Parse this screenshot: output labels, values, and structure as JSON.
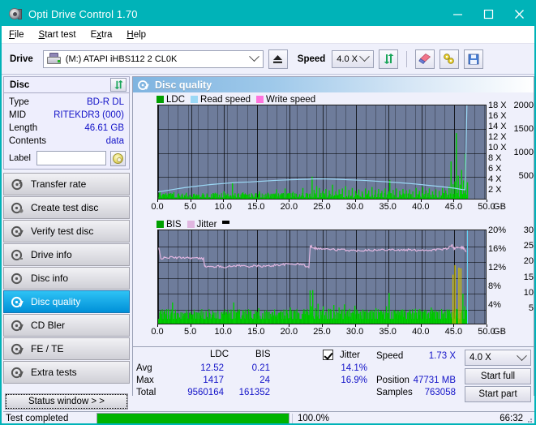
{
  "window": {
    "title": "Opti Drive Control 1.70",
    "icon": "disc-icon",
    "minimize": "minimize-icon",
    "maximize": "maximize-icon",
    "close": "close-icon",
    "titlebar_color": "#00b3b8"
  },
  "menu": [
    {
      "label": "File",
      "accel": "F"
    },
    {
      "label": "Start test",
      "accel": "S"
    },
    {
      "label": "Extra",
      "accel": "x"
    },
    {
      "label": "Help",
      "accel": "H"
    }
  ],
  "toolbar": {
    "drive_label": "Drive",
    "drive_value": "(M:)  ATAPI iHBS112  2 CL0K",
    "eject_icon": "eject-icon",
    "speed_label": "Speed",
    "speed_value": "4.0 X",
    "refresh_icon": "refresh-icon",
    "eraser_icon": "eraser-icon",
    "tools_icon": "tools-icon",
    "save_icon": "save-icon"
  },
  "disc_panel": {
    "header": "Disc",
    "refresh_icon": "refresh-icon",
    "rows": [
      {
        "key": "Type",
        "value": "BD-R DL"
      },
      {
        "key": "MID",
        "value": "RITEKDR3 (000)"
      },
      {
        "key": "Length",
        "value": "46.61 GB"
      },
      {
        "key": "Contents",
        "value": "data"
      }
    ],
    "label_key": "Label",
    "label_value": "",
    "label_placeholder": "",
    "cd_icon": "cd-icon"
  },
  "nav": {
    "items": [
      {
        "label": "Transfer rate",
        "icon": "disc-transfer-icon",
        "selected": false
      },
      {
        "label": "Create test disc",
        "icon": "disc-create-icon",
        "selected": false
      },
      {
        "label": "Verify test disc",
        "icon": "disc-verify-icon",
        "selected": false
      },
      {
        "label": "Drive info",
        "icon": "drive-info-icon",
        "selected": false
      },
      {
        "label": "Disc info",
        "icon": "disc-info-icon",
        "selected": false
      },
      {
        "label": "Disc quality",
        "icon": "disc-quality-icon",
        "selected": true
      },
      {
        "label": "CD Bler",
        "icon": "cd-bler-icon",
        "selected": false
      },
      {
        "label": "FE / TE",
        "icon": "fe-te-icon",
        "selected": false
      },
      {
        "label": "Extra tests",
        "icon": "extra-tests-icon",
        "selected": false
      }
    ],
    "status_window": "Status window > >"
  },
  "content": {
    "header": "Disc quality",
    "header_icon": "disc-quality-icon"
  },
  "stats": {
    "col_ldc": "LDC",
    "col_bis": "BIS",
    "row_avg": "Avg",
    "row_max": "Max",
    "row_total": "Total",
    "ldc_avg": "12.52",
    "ldc_max": "1417",
    "ldc_total": "9560164",
    "bis_avg": "0.21",
    "bis_max": "24",
    "bis_total": "161352",
    "jitter_label": "Jitter",
    "jitter_checked": true,
    "jitter_avg": "14.1%",
    "jitter_max": "16.9%",
    "speed_label": "Speed",
    "speed_value": "1.73 X",
    "position_label": "Position",
    "position_value": "47731 MB",
    "samples_label": "Samples",
    "samples_value": "763058",
    "speed_select": "4.0 X",
    "start_full": "Start full",
    "start_part": "Start part"
  },
  "statusbar": {
    "text": "Test completed",
    "percent": "100.0%",
    "progress": 100,
    "elapsed": "66:32",
    "progress_color": "#00b300"
  },
  "chart_data": [
    {
      "id": "ldc-chart",
      "type": "line",
      "title": "",
      "xlabel": "GB",
      "ylabel": "",
      "xlim": [
        0,
        50
      ],
      "ylim": [
        0,
        2000
      ],
      "y2lim": [
        0,
        18
      ],
      "xticks": [
        "0.0",
        "5.0",
        "10.0",
        "15.0",
        "20.0",
        "25.0",
        "30.0",
        "35.0",
        "40.0",
        "45.0",
        "50.0"
      ],
      "xtick_values": [
        0,
        5,
        10,
        15,
        20,
        25,
        30,
        35,
        40,
        45,
        50
      ],
      "x_unit": "GB",
      "yticks": [
        "500",
        "1000",
        "1500",
        "2000"
      ],
      "ytick_values": [
        500,
        1000,
        1500,
        2000
      ],
      "y2ticks": [
        "2 X",
        "4 X",
        "6 X",
        "8 X",
        "10 X",
        "12 X",
        "14 X",
        "16 X",
        "18 X"
      ],
      "y2tick_values": [
        2,
        4,
        6,
        8,
        10,
        12,
        14,
        16,
        18
      ],
      "grid": true,
      "legend_position": "top-left",
      "legend": [
        {
          "name": "LDC",
          "color": "#00b400"
        },
        {
          "name": "Read speed",
          "color": "#9bd8f5"
        },
        {
          "name": "Write speed",
          "color": "#ff74de"
        }
      ],
      "series": [
        {
          "name": "Read speed",
          "color": "#9bd8f5",
          "axis": "right",
          "x": [
            0.0,
            1.0,
            2.5,
            4.0,
            6.0,
            8.0,
            10.0,
            12.0,
            14.0,
            16.0,
            18.0,
            20.0,
            21.5,
            23.0,
            23.3,
            24.0,
            25.5,
            27.0,
            29.0,
            31.0,
            33.0,
            35.0,
            37.0,
            39.0,
            41.0,
            43.0,
            45.0,
            46.2,
            46.6,
            46.7,
            46.8,
            46.9
          ],
          "values": [
            1.6,
            1.8,
            2.1,
            2.4,
            2.7,
            3.0,
            3.2,
            3.4,
            3.5,
            3.65,
            3.8,
            3.9,
            3.95,
            4.0,
            4.05,
            4.08,
            4.05,
            4.0,
            3.9,
            3.8,
            3.65,
            3.5,
            3.3,
            3.1,
            2.85,
            2.6,
            2.3,
            2.05,
            2.0,
            5.0,
            12.0,
            18.0
          ]
        },
        {
          "name": "LDC",
          "color": "#00b400",
          "axis": "left",
          "note": "dense green spike histogram, baseline ~60, typical spikes 100-350, large spikes near 44-47 GB up to 1417",
          "baseline": 60,
          "spike_x": [
            0.2,
            0.6,
            1.1,
            1.7,
            2.3,
            2.9,
            3.5,
            4.2,
            4.8,
            5.4,
            6.1,
            6.7,
            7.3,
            8.0,
            8.6,
            9.2,
            9.9,
            10.5,
            11.2,
            11.6,
            12.1,
            12.8,
            13.4,
            14.1,
            14.7,
            15.3,
            16.0,
            16.6,
            17.3,
            17.9,
            18.5,
            19.2,
            19.8,
            20.4,
            20.9,
            21.4,
            21.9,
            22.4,
            22.9,
            23.3,
            23.6,
            24.0,
            24.4,
            24.9,
            25.4,
            25.9,
            26.4,
            26.9,
            27.4,
            27.9,
            28.4,
            28.9,
            29.4,
            29.9,
            30.4,
            30.9,
            31.4,
            31.9,
            32.4,
            32.9,
            33.4,
            33.9,
            34.4,
            34.9,
            35.1,
            35.6,
            36.1,
            36.6,
            37.1,
            37.6,
            38.1,
            38.6,
            39.1,
            39.6,
            40.1,
            40.6,
            41.1,
            41.6,
            42.1,
            42.6,
            43.1,
            43.6,
            44.1,
            44.4,
            44.7,
            45.0,
            45.2,
            45.5,
            45.8,
            46.0,
            46.3,
            46.6,
            46.9
          ],
          "spike_values": [
            190,
            120,
            150,
            110,
            170,
            130,
            120,
            160,
            110,
            140,
            120,
            150,
            110,
            130,
            160,
            120,
            190,
            140,
            380,
            150,
            130,
            170,
            120,
            150,
            130,
            190,
            120,
            160,
            140,
            230,
            130,
            250,
            150,
            180,
            140,
            130,
            260,
            150,
            130,
            500,
            220,
            300,
            260,
            200,
            240,
            210,
            330,
            190,
            230,
            250,
            300,
            220,
            260,
            200,
            230,
            190,
            250,
            210,
            280,
            220,
            240,
            200,
            250,
            190,
            430,
            220,
            250,
            200,
            240,
            210,
            230,
            190,
            260,
            200,
            280,
            210,
            250,
            190,
            230,
            200,
            260,
            210,
            300,
            820,
            340,
            400,
            1417,
            520,
            330,
            640,
            420,
            980,
            380
          ]
        }
      ]
    },
    {
      "id": "bis-chart",
      "type": "line",
      "title": "",
      "xlabel": "GB",
      "ylabel": "",
      "xlim": [
        0,
        50
      ],
      "ylim": [
        0,
        30
      ],
      "y2lim": [
        0,
        20
      ],
      "xticks": [
        "0.0",
        "5.0",
        "10.0",
        "15.0",
        "20.0",
        "25.0",
        "30.0",
        "35.0",
        "40.0",
        "45.0",
        "50.0"
      ],
      "xtick_values": [
        0,
        5,
        10,
        15,
        20,
        25,
        30,
        35,
        40,
        45,
        50
      ],
      "x_unit": "GB",
      "yticks": [
        "5",
        "10",
        "15",
        "20",
        "25",
        "30"
      ],
      "ytick_values": [
        5,
        10,
        15,
        20,
        25,
        30
      ],
      "y2ticks": [
        "4%",
        "8%",
        "12%",
        "16%",
        "20%"
      ],
      "y2tick_values": [
        4,
        8,
        12,
        16,
        20
      ],
      "grid": true,
      "legend_position": "top-left",
      "legend": [
        {
          "name": "BIS",
          "color": "#00b400"
        },
        {
          "name": "Jitter",
          "color": "#e0b6e0"
        }
      ],
      "series": [
        {
          "name": "Jitter",
          "color": "#e0b6e0",
          "axis": "right",
          "x": [
            0.1,
            0.4,
            1.0,
            2.0,
            3.0,
            4.0,
            5.0,
            6.0,
            6.9,
            7.1,
            8.0,
            9.0,
            10.0,
            11.0,
            12.0,
            13.0,
            14.0,
            15.0,
            16.0,
            17.0,
            18.0,
            19.0,
            20.0,
            21.0,
            22.0,
            22.9,
            23.1,
            23.4,
            24.0,
            25.0,
            26.0,
            27.0,
            28.0,
            29.0,
            30.0,
            31.0,
            32.0,
            33.0,
            34.0,
            35.0,
            36.0,
            37.0,
            38.0,
            39.0,
            40.0,
            41.0,
            42.0,
            43.0,
            44.0,
            44.6,
            45.0,
            45.4,
            45.8,
            46.3,
            46.8
          ],
          "values": [
            16.3,
            14.1,
            14.2,
            14.3,
            14.2,
            14.3,
            14.2,
            14.1,
            14.0,
            12.4,
            12.3,
            12.4,
            12.3,
            12.4,
            12.6,
            12.5,
            12.4,
            12.5,
            12.4,
            12.5,
            12.7,
            12.8,
            12.9,
            12.9,
            12.8,
            12.1,
            16.8,
            16.5,
            16.2,
            16.1,
            16.0,
            15.9,
            15.9,
            15.8,
            15.7,
            15.8,
            15.9,
            15.8,
            15.9,
            16.0,
            15.9,
            15.8,
            15.9,
            15.8,
            15.9,
            15.8,
            15.9,
            16.0,
            16.1,
            16.9,
            16.1,
            16.5,
            16.2,
            16.4,
            15.6
          ]
        },
        {
          "name": "BIS",
          "color": "#00b400",
          "axis": "left",
          "note": "dense green spike histogram, baseline ~2, typical spikes 3-7, max 24 near 45 GB (rendered dark yellow where overlapping)",
          "baseline": 2,
          "spike_x": [
            0.3,
            0.9,
            1.5,
            2.1,
            2.4,
            3.0,
            3.6,
            4.2,
            4.8,
            5.4,
            6.0,
            6.6,
            7.2,
            7.8,
            8.4,
            9.0,
            9.6,
            10.2,
            10.8,
            11.4,
            11.6,
            12.2,
            12.8,
            13.4,
            14.0,
            14.6,
            15.2,
            15.8,
            16.4,
            17.0,
            17.6,
            18.2,
            18.8,
            19.4,
            20.0,
            20.6,
            21.2,
            21.8,
            22.4,
            23.0,
            23.2,
            23.4,
            23.8,
            24.2,
            24.6,
            25.0,
            25.4,
            25.8,
            26.2,
            26.6,
            27.0,
            27.4,
            27.8,
            28.2,
            28.6,
            29.0,
            29.4,
            29.8,
            30.2,
            30.6,
            31.0,
            31.4,
            31.8,
            32.2,
            32.6,
            33.0,
            33.4,
            33.8,
            34.2,
            34.6,
            35.0,
            35.4,
            35.8,
            36.2,
            36.6,
            37.0,
            37.4,
            37.8,
            38.2,
            38.6,
            39.0,
            39.4,
            39.8,
            40.2,
            40.6,
            41.0,
            41.4,
            41.8,
            42.2,
            42.6,
            43.0,
            43.4,
            43.8,
            44.2,
            44.7,
            45.0,
            45.3,
            45.6,
            45.9,
            46.2,
            46.5,
            46.8
          ],
          "spike_values": [
            4.5,
            3.5,
            5.0,
            7.2,
            3.8,
            3.5,
            4.0,
            3.6,
            4.2,
            3.5,
            4.0,
            3.4,
            4.5,
            3.6,
            4.0,
            3.5,
            4.2,
            3.6,
            4.0,
            7.2,
            4.5,
            3.6,
            4.8,
            3.5,
            4.2,
            3.6,
            5.4,
            3.8,
            4.0,
            3.6,
            5.0,
            3.8,
            4.2,
            3.6,
            5.6,
            3.8,
            4.0,
            3.6,
            4.4,
            11.0,
            6.0,
            11.1,
            5.4,
            6.8,
            4.6,
            6.0,
            4.2,
            5.2,
            4.6,
            6.4,
            4.4,
            5.6,
            4.2,
            6.6,
            4.4,
            5.2,
            4.0,
            6.2,
            4.6,
            4.2,
            5.0,
            4.4,
            4.0,
            4.6,
            4.2,
            5.4,
            4.0,
            4.6,
            4.2,
            6.0,
            10.2,
            4.4,
            4.0,
            4.6,
            4.2,
            5.0,
            4.4,
            4.0,
            4.6,
            4.2,
            5.2,
            4.0,
            4.4,
            4.2,
            4.8,
            4.0,
            5.6,
            4.2,
            4.4,
            4.0,
            4.8,
            4.2,
            5.0,
            4.4,
            16.0,
            19.0,
            5.2,
            18.2,
            18.0,
            10.0,
            6.0,
            4.4
          ]
        }
      ],
      "cursor_line": {
        "x": 46.9,
        "color": "#62d4f5"
      },
      "marker_icon": "black-marker"
    }
  ]
}
